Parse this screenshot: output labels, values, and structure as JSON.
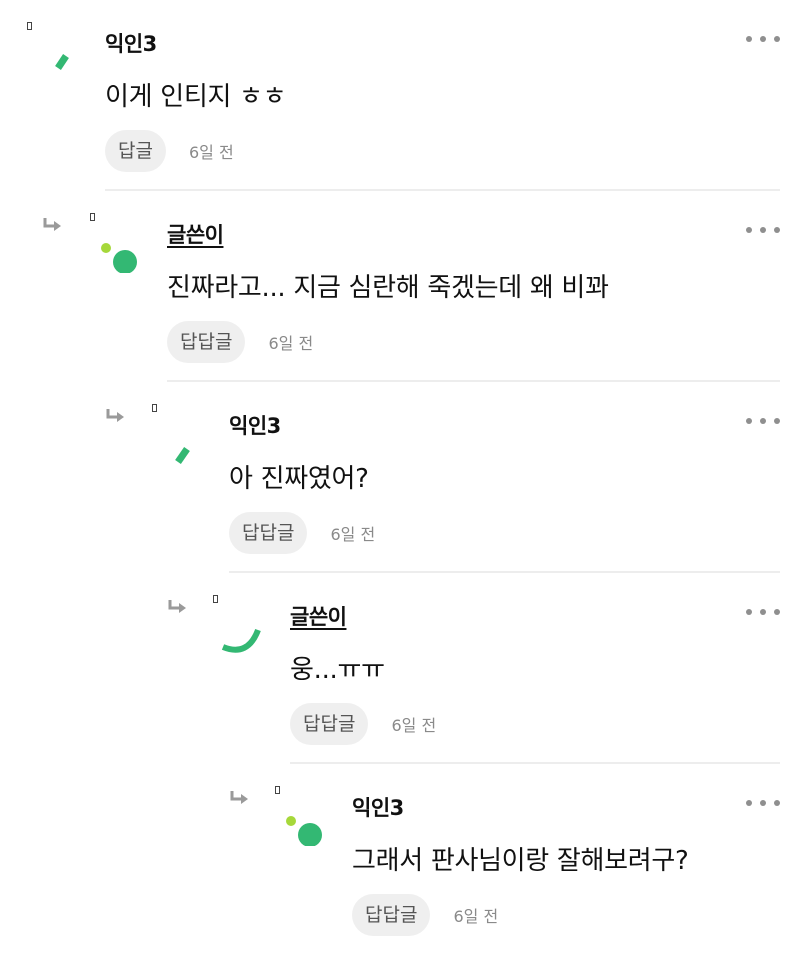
{
  "colors": {
    "accent_green": "#33b873",
    "accent_lime": "#a6d83a",
    "button_bg": "#efefef",
    "divider": "#ededed"
  },
  "comments": [
    {
      "author": "익인3",
      "text": "이게 인티지 ㅎㅎ",
      "reply_label": "답글",
      "time": "6일 전",
      "avatar": "green-slash-icon"
    },
    {
      "author": "글쓴이",
      "text": "진짜라고... 지금 심란해 죽겠는데 왜 비꽈",
      "reply_label": "답답글",
      "time": "6일 전",
      "avatar": "green-dots-icon"
    },
    {
      "author": "익인3",
      "text": "아 진짜였어?",
      "reply_label": "답답글",
      "time": "6일 전",
      "avatar": "green-slash-icon"
    },
    {
      "author": "글쓴이",
      "text": "웅...ㅠㅠ",
      "reply_label": "답답글",
      "time": "6일 전",
      "avatar": "green-arc-icon"
    },
    {
      "author": "익인3",
      "text": "그래서 판사님이랑 잘해보려구?",
      "reply_label": "답답글",
      "time": "6일 전",
      "avatar": "green-dots-icon"
    }
  ]
}
